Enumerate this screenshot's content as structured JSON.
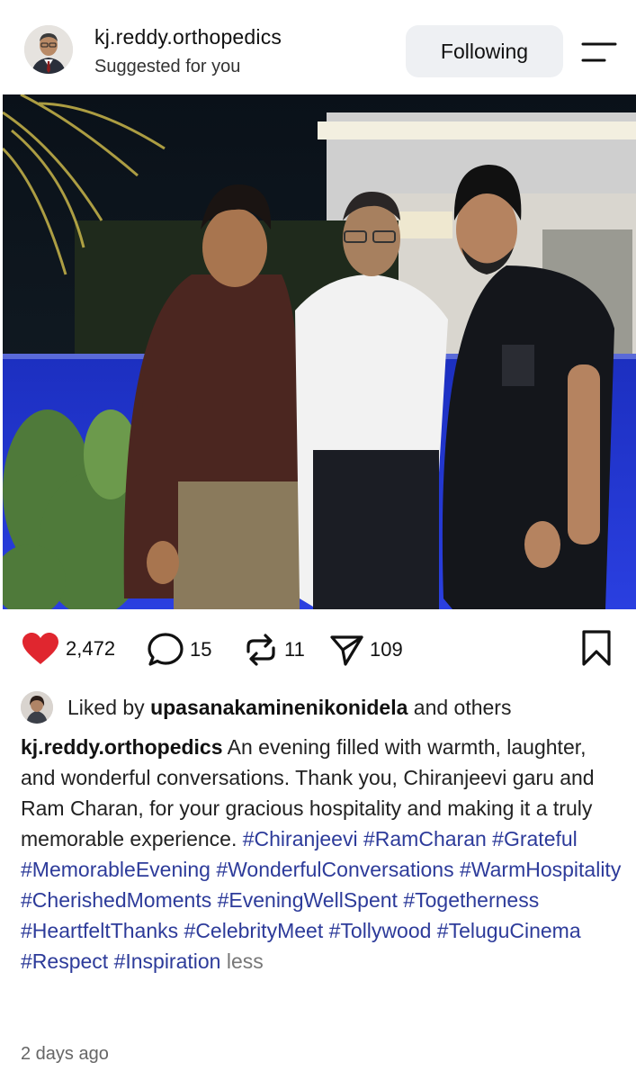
{
  "header": {
    "username": "kj.reddy.orthopedics",
    "subtitle": "Suggested for you",
    "follow_label": "Following",
    "avatar_icon": "profile-avatar-icon",
    "menu_icon": "menu-icon"
  },
  "post": {
    "photo_description_icon": "post-photo"
  },
  "actions": {
    "likes": "2,472",
    "comments": "15",
    "reposts": "11",
    "shares": "109",
    "like_color": "#e0262f"
  },
  "liked_by": {
    "prefix": "Liked by ",
    "user": "upasanakaminenikonidela",
    "suffix": " and others"
  },
  "caption": {
    "user": "kj.reddy.orthopedics",
    "text": " An evening filled with warmth, laughter, and wonderful conversations. Thank you, Chiranjeevi garu and Ram Charan, for your gracious hospitality and making it a truly memorable experience.",
    "hashtags": [
      "#Chiranjeevi",
      "#RamCharan",
      "#Grateful",
      "#MemorableEvening",
      "#WonderfulConversations",
      "#WarmHospitality",
      "#CherishedMoments",
      "#EveningWellSpent",
      "#Togetherness",
      "#HeartfeltThanks",
      "#CelebrityMeet",
      "#Tollywood",
      "#TeluguCinema",
      "#Respect",
      "#Inspiration"
    ],
    "less_label": "less",
    "hashtag_color": "#2d3b9a"
  },
  "timestamp": "2 days ago"
}
